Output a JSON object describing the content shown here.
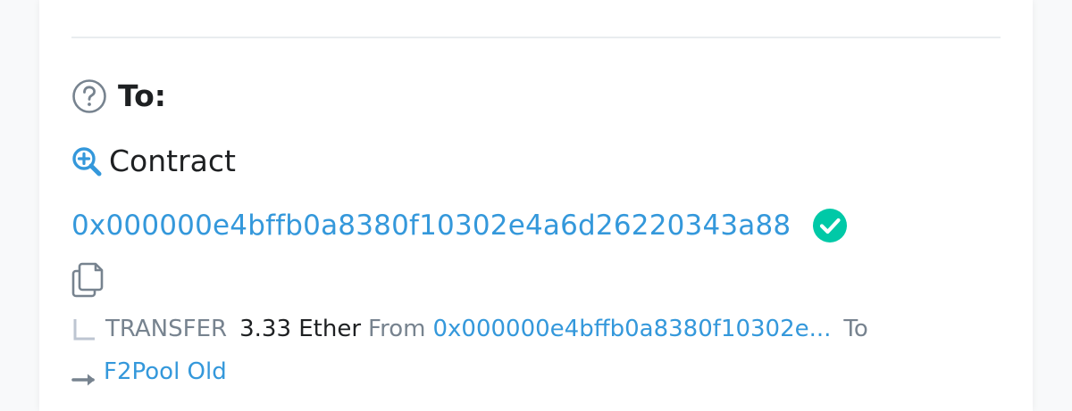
{
  "to_section": {
    "label": "To:"
  },
  "contract": {
    "label": "Contract",
    "address": "0x000000e4bffb0a8380f10302e4a6d26220343a88"
  },
  "transfer": {
    "type_label": "TRANSFER",
    "amount": "3.33 Ether",
    "from_label": "From",
    "from_address": "0x000000e4bffb0a8380f10302e...",
    "to_label": "To",
    "to_name": "F2Pool Old"
  },
  "colors": {
    "link": "#3498db",
    "verified": "#00c9a7",
    "muted": "#77838f"
  },
  "icons": {
    "help": "question-circle-icon",
    "zoom": "zoom-in-icon",
    "verified": "check-circle-icon",
    "copy": "copy-icon",
    "corner": "corner-down-right-icon",
    "arrow": "arrow-right-icon"
  }
}
